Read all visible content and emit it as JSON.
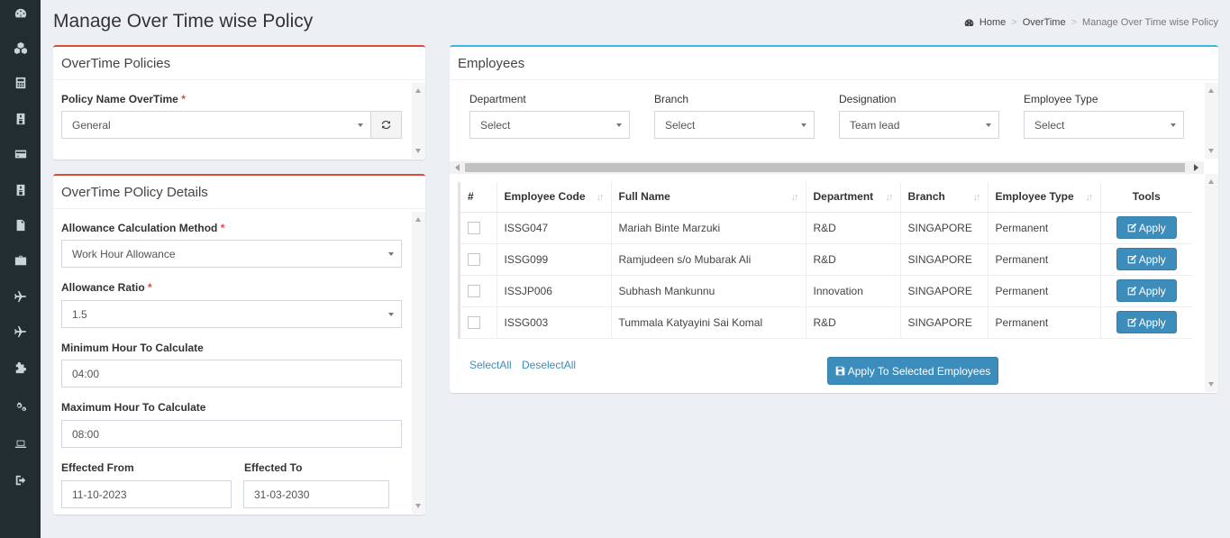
{
  "header": {
    "title": "Manage Over Time wise Policy",
    "breadcrumb": {
      "home": "Home",
      "section": "OverTime",
      "current": "Manage Over Time wise Policy"
    }
  },
  "sidebar": {
    "icons": [
      "dashboard-icon",
      "cubes-icon",
      "calculator-icon",
      "id-card-icon",
      "credit-card-icon",
      "id-badge-icon",
      "file-icon",
      "briefcase-icon",
      "plane-icon",
      "plane-icon",
      "puzzle-icon",
      "cogs-icon",
      "laptop-icon",
      "sign-out-icon"
    ]
  },
  "policies": {
    "title": "OverTime Policies",
    "policy_label": "Policy Name OverTime",
    "policy_value": "General"
  },
  "details": {
    "title": "OverTime POlicy Details",
    "method_label": "Allowance Calculation Method",
    "method_value": "Work Hour Allowance",
    "ratio_label": "Allowance Ratio",
    "ratio_value": "1.5",
    "min_label": "Minimum Hour To Calculate",
    "min_value": "04:00",
    "max_label": "Maximum Hour To Calculate",
    "max_value": "08:00",
    "from_label": "Effected From",
    "from_value": "11-10-2023",
    "to_label": "Effected To",
    "to_value": "31-03-2030"
  },
  "employees": {
    "title": "Employees",
    "filters": {
      "department_label": "Department",
      "department_value": "Select",
      "branch_label": "Branch",
      "branch_value": "Select",
      "designation_label": "Designation",
      "designation_value": "Team lead",
      "type_label": "Employee Type",
      "type_value": "Select"
    },
    "columns": [
      "#",
      "Employee Code",
      "Full Name",
      "Department",
      "Branch",
      "Employee Type",
      "Tools"
    ],
    "rows": [
      {
        "code": "ISSG047",
        "name": "Mariah Binte Marzuki",
        "department": "R&D",
        "branch": "SINGAPORE",
        "type": "Permanent"
      },
      {
        "code": "ISSG099",
        "name": "Ramjudeen s/o Mubarak Ali",
        "department": "R&D",
        "branch": "SINGAPORE",
        "type": "Permanent"
      },
      {
        "code": "ISSJP006",
        "name": "Subhash Mankunnu",
        "department": "Innovation",
        "branch": "SINGAPORE",
        "type": "Permanent"
      },
      {
        "code": "ISSG003",
        "name": "Tummala Katyayini Sai Komal",
        "department": "R&D",
        "branch": "SINGAPORE",
        "type": "Permanent"
      }
    ],
    "apply_label": "Apply",
    "select_all": "SelectAll",
    "deselect_all": "DeselectAll",
    "apply_selected": "Apply To Selected Employees"
  },
  "colors": {
    "sidebar": "#222d32",
    "primary": "#3c8dbc",
    "danger": "#dd4b39",
    "info": "#3fb6dc",
    "background": "#ecf0f5"
  }
}
